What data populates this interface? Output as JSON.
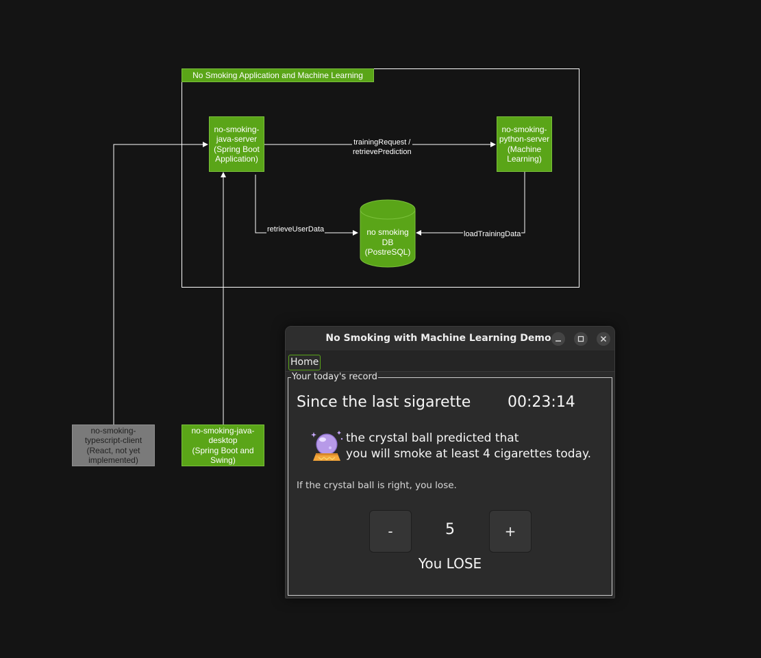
{
  "diagram": {
    "group_label": "No Smoking Application and Machine Learning",
    "java_server": "no-smoking-\njava-server\n(Spring Boot\nApplication)",
    "python_server": "no-smoking-\npython-server\n(Machine\nLearning)",
    "db": "no smoking\nDB\n(PostreSQL)",
    "ts_client": "no-smoking-\ntypescript-client\n(React, not yet\nimplemented)",
    "java_desktop": "no-smoking-java-\ndesktop\n(Spring Boot and\nSwing)",
    "edge_training": "trainingRequest /\nretrievePrediction",
    "edge_user_data": "retrieveUserData",
    "edge_load_training": "loadTrainingData",
    "colors": {
      "node": "#5aa518",
      "node_disabled": "#7a7a7a",
      "edge": "#ffffff"
    }
  },
  "window": {
    "title": "No Smoking with Machine Learning Demo",
    "controls": {
      "minimize": "minimize-icon",
      "maximize": "maximize-icon",
      "close": "close-icon"
    },
    "tabs": [
      {
        "label": "Home",
        "active": true
      }
    ],
    "panel": {
      "legend": "Your today's record",
      "since_label": "Since the last sigarette",
      "timer": "00:23:14",
      "prediction": "the crystal ball predicted that\nyou will smoke at least 4 cigarettes today.",
      "rule": "If the crystal ball is right, you lose.",
      "decrement_label": "-",
      "increment_label": "+",
      "count": "5",
      "result": "You LOSE"
    },
    "colors": {
      "accent": "#5aa518",
      "background": "#2b2b2b"
    }
  }
}
